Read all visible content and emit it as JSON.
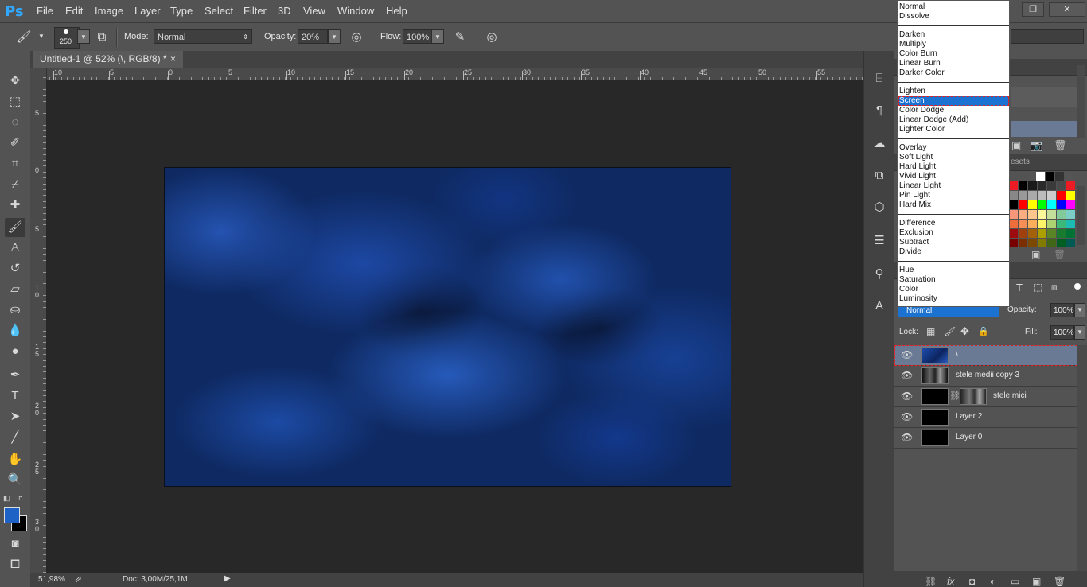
{
  "app": {
    "logo": "Ps"
  },
  "menubar": {
    "items": [
      "File",
      "Edit",
      "Image",
      "Layer",
      "Type",
      "Select",
      "Filter",
      "3D",
      "View",
      "Window",
      "Help"
    ]
  },
  "window_controls": {
    "minimize": "–",
    "restore": "❐",
    "close": "✕"
  },
  "options": {
    "brush_size": "250",
    "mode_label": "Mode:",
    "mode_value": "Normal",
    "opacity_label": "Opacity:",
    "opacity_value": "20%",
    "flow_label": "Flow:",
    "flow_value": "100%"
  },
  "document": {
    "tab_title": "Untitled-1 @ 52% (\\, RGB/8) *",
    "tab_close": "×",
    "ruler_h_labels": [
      "10",
      "5",
      "0",
      "5",
      "10",
      "15",
      "20",
      "25",
      "30",
      "35",
      "40",
      "45",
      "50",
      "55"
    ],
    "ruler_v_labels": [
      "5",
      "0",
      "5",
      "1\n0",
      "1\n5",
      "2\n0",
      "2\n5",
      "3\n0"
    ]
  },
  "status": {
    "zoom": "51,98%",
    "doc_info": "Doc: 3,00M/25,1M"
  },
  "blend_menu": {
    "groups": [
      [
        "Normal",
        "Dissolve"
      ],
      [
        "Darken",
        "Multiply",
        "Color Burn",
        "Linear Burn",
        "Darker Color"
      ],
      [
        "Lighten",
        "Screen",
        "Color Dodge",
        "Linear Dodge (Add)",
        "Lighter Color"
      ],
      [
        "Overlay",
        "Soft Light",
        "Hard Light",
        "Vivid Light",
        "Linear Light",
        "Pin Light",
        "Hard Mix"
      ],
      [
        "Difference",
        "Exclusion",
        "Subtract",
        "Divide"
      ],
      [
        "Hue",
        "Saturation",
        "Color",
        "Luminosity"
      ]
    ],
    "selected": "Screen"
  },
  "swatches_panel": {
    "tab_fragment": "esets"
  },
  "layers_panel": {
    "blend_mode": "Normal",
    "opacity_label": "Opacity:",
    "opacity_value": "100%",
    "lock_label": "Lock:",
    "fill_label": "Fill:",
    "fill_value": "100%",
    "layers": [
      {
        "name": "\\",
        "selected": true
      },
      {
        "name": "stele medii copy 3",
        "selected": false
      },
      {
        "name": "stele mici",
        "selected": false,
        "has_mask": true
      },
      {
        "name": "Layer 2",
        "selected": false
      },
      {
        "name": "Layer 0",
        "selected": false
      }
    ]
  },
  "colors": {
    "foreground": "#1f62c5",
    "background": "#000000",
    "selection": "#1c72d0",
    "accent": "#31a8ff"
  }
}
